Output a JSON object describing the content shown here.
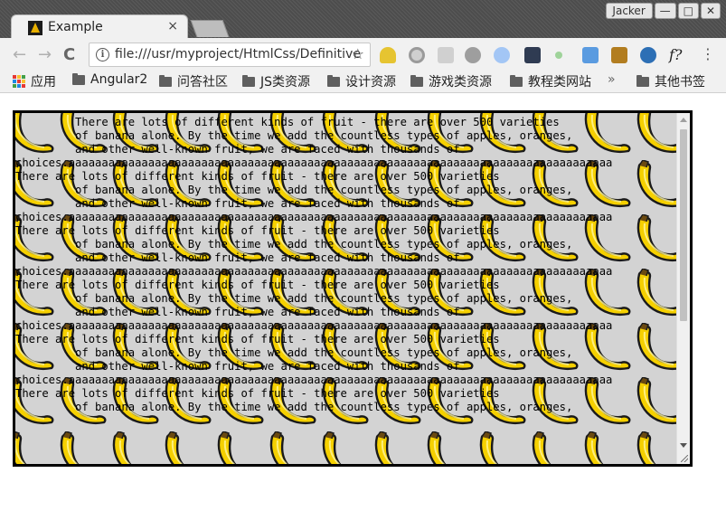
{
  "window": {
    "user_label": "Jacker",
    "minimize_label": "—",
    "maximize_label": "□",
    "close_label": "✕"
  },
  "tabs": [
    {
      "title": "Example",
      "close_label": "×"
    }
  ],
  "toolbar": {
    "back_label": "←",
    "forward_label": "→",
    "reload_label": "C",
    "url": "file:///usr/myproject/HtmlCss/Definitive",
    "info_label": "i",
    "star_label": "☆",
    "menu_label": "⋮",
    "ext_font_label": "f?"
  },
  "bookmarks": {
    "apps_label": "应用",
    "items": [
      "Angular2",
      "问答社区",
      "JS类资源",
      "设计资源",
      "游戏类资源",
      "教程类网站"
    ],
    "overflow_label": "»",
    "other_label": "其他书签"
  },
  "content": {
    "text": "         There are lots of different kinds of fruit - there are over 500 varieties\n         of banana alone. By the time we add the countless types of apples, oranges,\n         and other well-known fruit, we are faced with thousands of\nchoices.aaaaaaaaaaaaaaaaaaaaaaaaaaaaaaaaaaaaaaaaaaaaaaaaaaaaaaaaaaaaaaaaaaaaaaaaaaaaaaaaaa\nThere are lots of different kinds of fruit - there are over 500 varieties\n         of banana alone. By the time we add the countless types of apples, oranges,\n         and other well-known fruit, we are faced with thousands of\nchoices.aaaaaaaaaaaaaaaaaaaaaaaaaaaaaaaaaaaaaaaaaaaaaaaaaaaaaaaaaaaaaaaaaaaaaaaaaaaaaaaaaa\nThere are lots of different kinds of fruit - there are over 500 varieties\n         of banana alone. By the time we add the countless types of apples, oranges,\n         and other well-known fruit, we are faced with thousands of\nchoices.aaaaaaaaaaaaaaaaaaaaaaaaaaaaaaaaaaaaaaaaaaaaaaaaaaaaaaaaaaaaaaaaaaaaaaaaaaaaaaaaaa\nThere are lots of different kinds of fruit - there are over 500 varieties\n         of banana alone. By the time we add the countless types of apples, oranges,\n         and other well-known fruit, we are faced with thousands of\nchoices.aaaaaaaaaaaaaaaaaaaaaaaaaaaaaaaaaaaaaaaaaaaaaaaaaaaaaaaaaaaaaaaaaaaaaaaaaaaaaaaaaa\nThere are lots of different kinds of fruit - there are over 500 varieties\n         of banana alone. By the time we add the countless types of apples, oranges,\n         and other well-known fruit, we are faced with thousands of\nchoices.aaaaaaaaaaaaaaaaaaaaaaaaaaaaaaaaaaaaaaaaaaaaaaaaaaaaaaaaaaaaaaaaaaaaaaaaaaaaaaaaaa\nThere are lots of different kinds of fruit - there are over 500 varieties\n         of banana alone. By the time we add the countless types of apples, oranges,"
  },
  "colors": {
    "banana": "#f5d000",
    "banana_outline": "#1a1a1a",
    "pattern_bg": "#d3d3d3"
  }
}
